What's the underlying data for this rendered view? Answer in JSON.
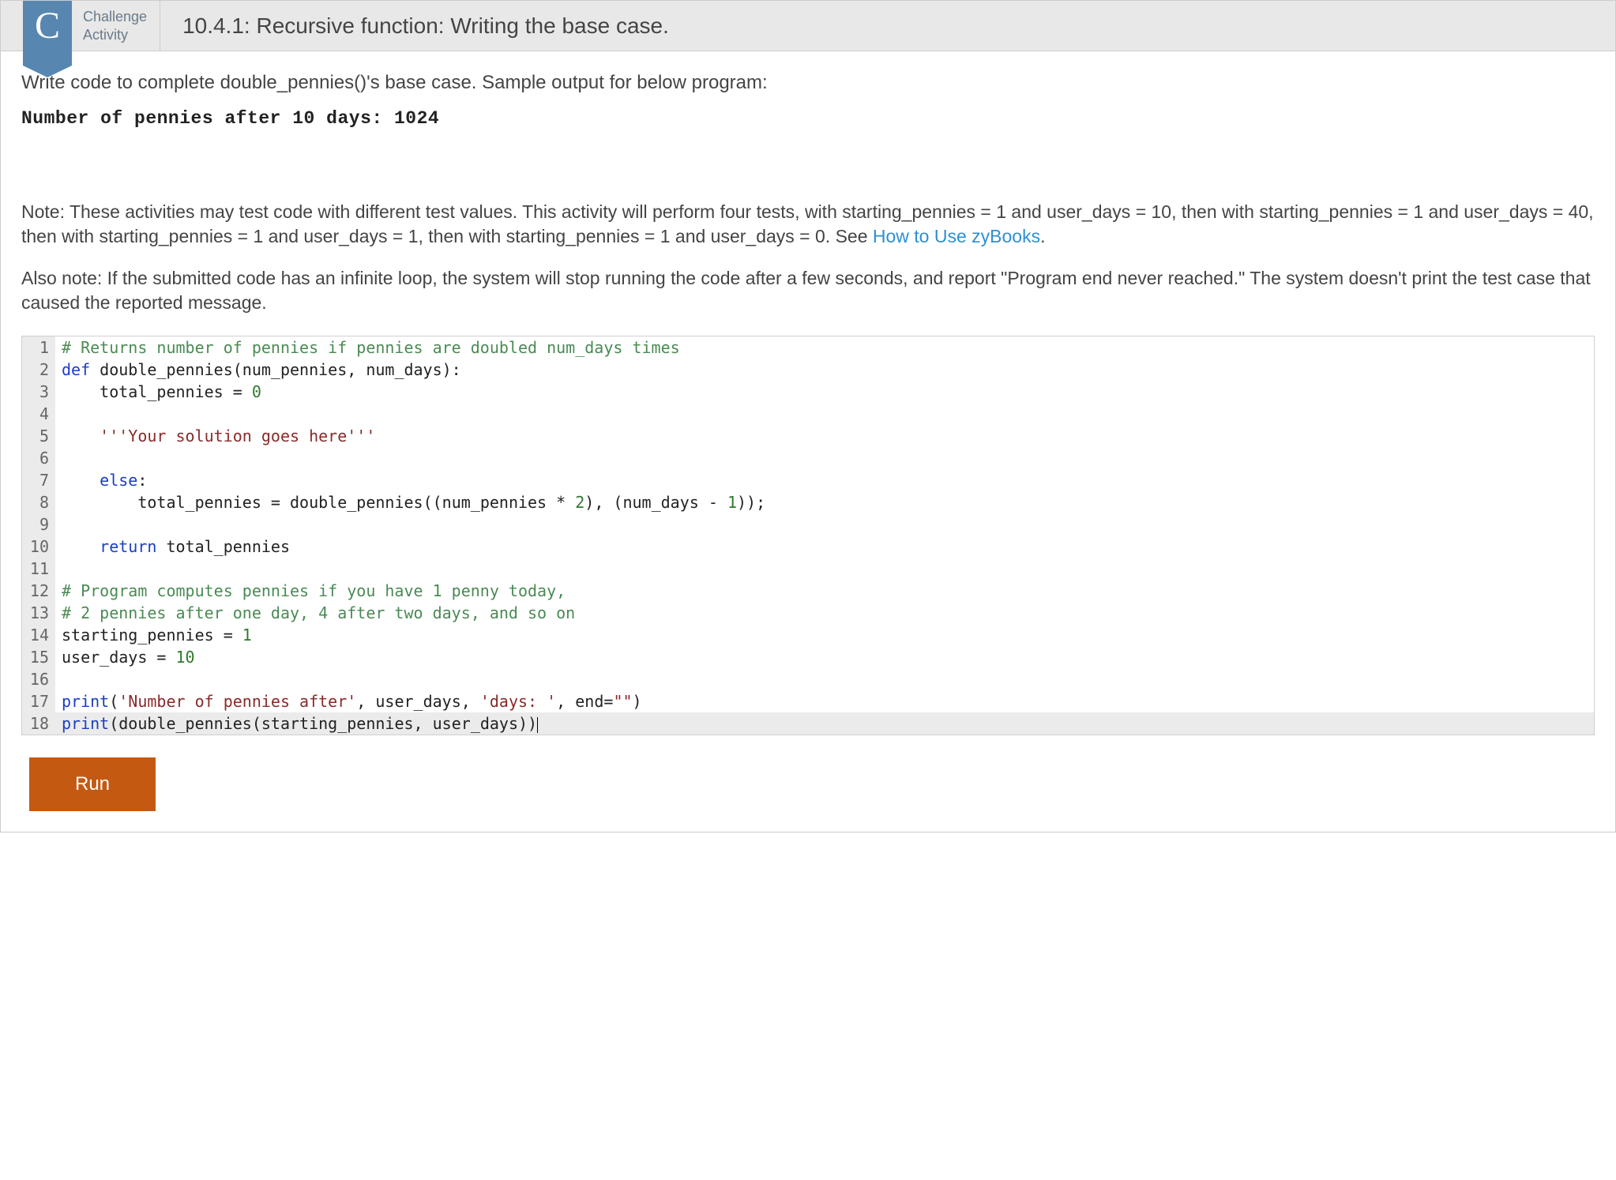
{
  "header": {
    "badge_letter": "C",
    "label_line1": "Challenge",
    "label_line2": "Activity",
    "title": "10.4.1: Recursive function: Writing the base case."
  },
  "prompt": "Write code to complete double_pennies()'s base case. Sample output for below program:",
  "sample_output": "Number of pennies after 10 days: 1024",
  "note_prefix": "Note: These activities may test code with different test values. This activity will perform four tests, with starting_pennies = 1 and user_days = 10, then with starting_pennies = 1 and user_days = 40, then with starting_pennies = 1 and user_days = 1, then with starting_pennies = 1 and user_days = 0. See ",
  "note_link": "How to Use zyBooks",
  "note_suffix": ".",
  "also_note": "Also note: If the submitted code has an infinite loop, the system will stop running the code after a few seconds, and report \"Program end never reached.\" The system doesn't print the test case that caused the reported message.",
  "code_lines": [
    {
      "n": 1,
      "tokens": [
        {
          "t": "# Returns number of pennies if pennies are doubled num_days times",
          "c": "comment"
        }
      ]
    },
    {
      "n": 2,
      "tokens": [
        {
          "t": "def",
          "c": "keyword"
        },
        {
          "t": " double_pennies(num_pennies, num_days):",
          "c": "name"
        }
      ]
    },
    {
      "n": 3,
      "tokens": [
        {
          "t": "    total_pennies ",
          "c": "name"
        },
        {
          "t": "=",
          "c": "op"
        },
        {
          "t": " ",
          "c": "name"
        },
        {
          "t": "0",
          "c": "number"
        }
      ]
    },
    {
      "n": 4,
      "tokens": [
        {
          "t": "",
          "c": "name"
        }
      ]
    },
    {
      "n": 5,
      "tokens": [
        {
          "t": "    ",
          "c": "name"
        },
        {
          "t": "'''Your solution goes here'''",
          "c": "string"
        }
      ]
    },
    {
      "n": 6,
      "tokens": [
        {
          "t": "",
          "c": "name"
        }
      ]
    },
    {
      "n": 7,
      "tokens": [
        {
          "t": "    ",
          "c": "name"
        },
        {
          "t": "else",
          "c": "keyword"
        },
        {
          "t": ":",
          "c": "name"
        }
      ]
    },
    {
      "n": 8,
      "tokens": [
        {
          "t": "        total_pennies ",
          "c": "name"
        },
        {
          "t": "=",
          "c": "op"
        },
        {
          "t": " double_pennies((num_pennies ",
          "c": "name"
        },
        {
          "t": "*",
          "c": "op"
        },
        {
          "t": " ",
          "c": "name"
        },
        {
          "t": "2",
          "c": "number"
        },
        {
          "t": "), (num_days ",
          "c": "name"
        },
        {
          "t": "-",
          "c": "op"
        },
        {
          "t": " ",
          "c": "name"
        },
        {
          "t": "1",
          "c": "number"
        },
        {
          "t": "));",
          "c": "name"
        }
      ]
    },
    {
      "n": 9,
      "tokens": [
        {
          "t": "",
          "c": "name"
        }
      ]
    },
    {
      "n": 10,
      "tokens": [
        {
          "t": "    ",
          "c": "name"
        },
        {
          "t": "return",
          "c": "keyword"
        },
        {
          "t": " total_pennies",
          "c": "name"
        }
      ]
    },
    {
      "n": 11,
      "tokens": [
        {
          "t": "",
          "c": "name"
        }
      ]
    },
    {
      "n": 12,
      "tokens": [
        {
          "t": "# Program computes pennies if you have 1 penny today,",
          "c": "comment"
        }
      ]
    },
    {
      "n": 13,
      "tokens": [
        {
          "t": "# 2 pennies after one day, 4 after two days, and so on",
          "c": "comment"
        }
      ]
    },
    {
      "n": 14,
      "tokens": [
        {
          "t": "starting_pennies ",
          "c": "name"
        },
        {
          "t": "=",
          "c": "op"
        },
        {
          "t": " ",
          "c": "name"
        },
        {
          "t": "1",
          "c": "number"
        }
      ]
    },
    {
      "n": 15,
      "tokens": [
        {
          "t": "user_days ",
          "c": "name"
        },
        {
          "t": "=",
          "c": "op"
        },
        {
          "t": " ",
          "c": "name"
        },
        {
          "t": "10",
          "c": "number"
        }
      ]
    },
    {
      "n": 16,
      "tokens": [
        {
          "t": "",
          "c": "name"
        }
      ]
    },
    {
      "n": 17,
      "tokens": [
        {
          "t": "print",
          "c": "builtin"
        },
        {
          "t": "(",
          "c": "name"
        },
        {
          "t": "'Number of pennies after'",
          "c": "string"
        },
        {
          "t": ", user_days, ",
          "c": "name"
        },
        {
          "t": "'days: '",
          "c": "string"
        },
        {
          "t": ", end",
          "c": "name"
        },
        {
          "t": "=",
          "c": "op"
        },
        {
          "t": "\"\"",
          "c": "string"
        },
        {
          "t": ")",
          "c": "name"
        }
      ]
    },
    {
      "n": 18,
      "current": true,
      "tokens": [
        {
          "t": "print",
          "c": "builtin"
        },
        {
          "t": "(double_pennies(starting_pennies, user_days))",
          "c": "name"
        }
      ]
    }
  ],
  "run_button": "Run"
}
